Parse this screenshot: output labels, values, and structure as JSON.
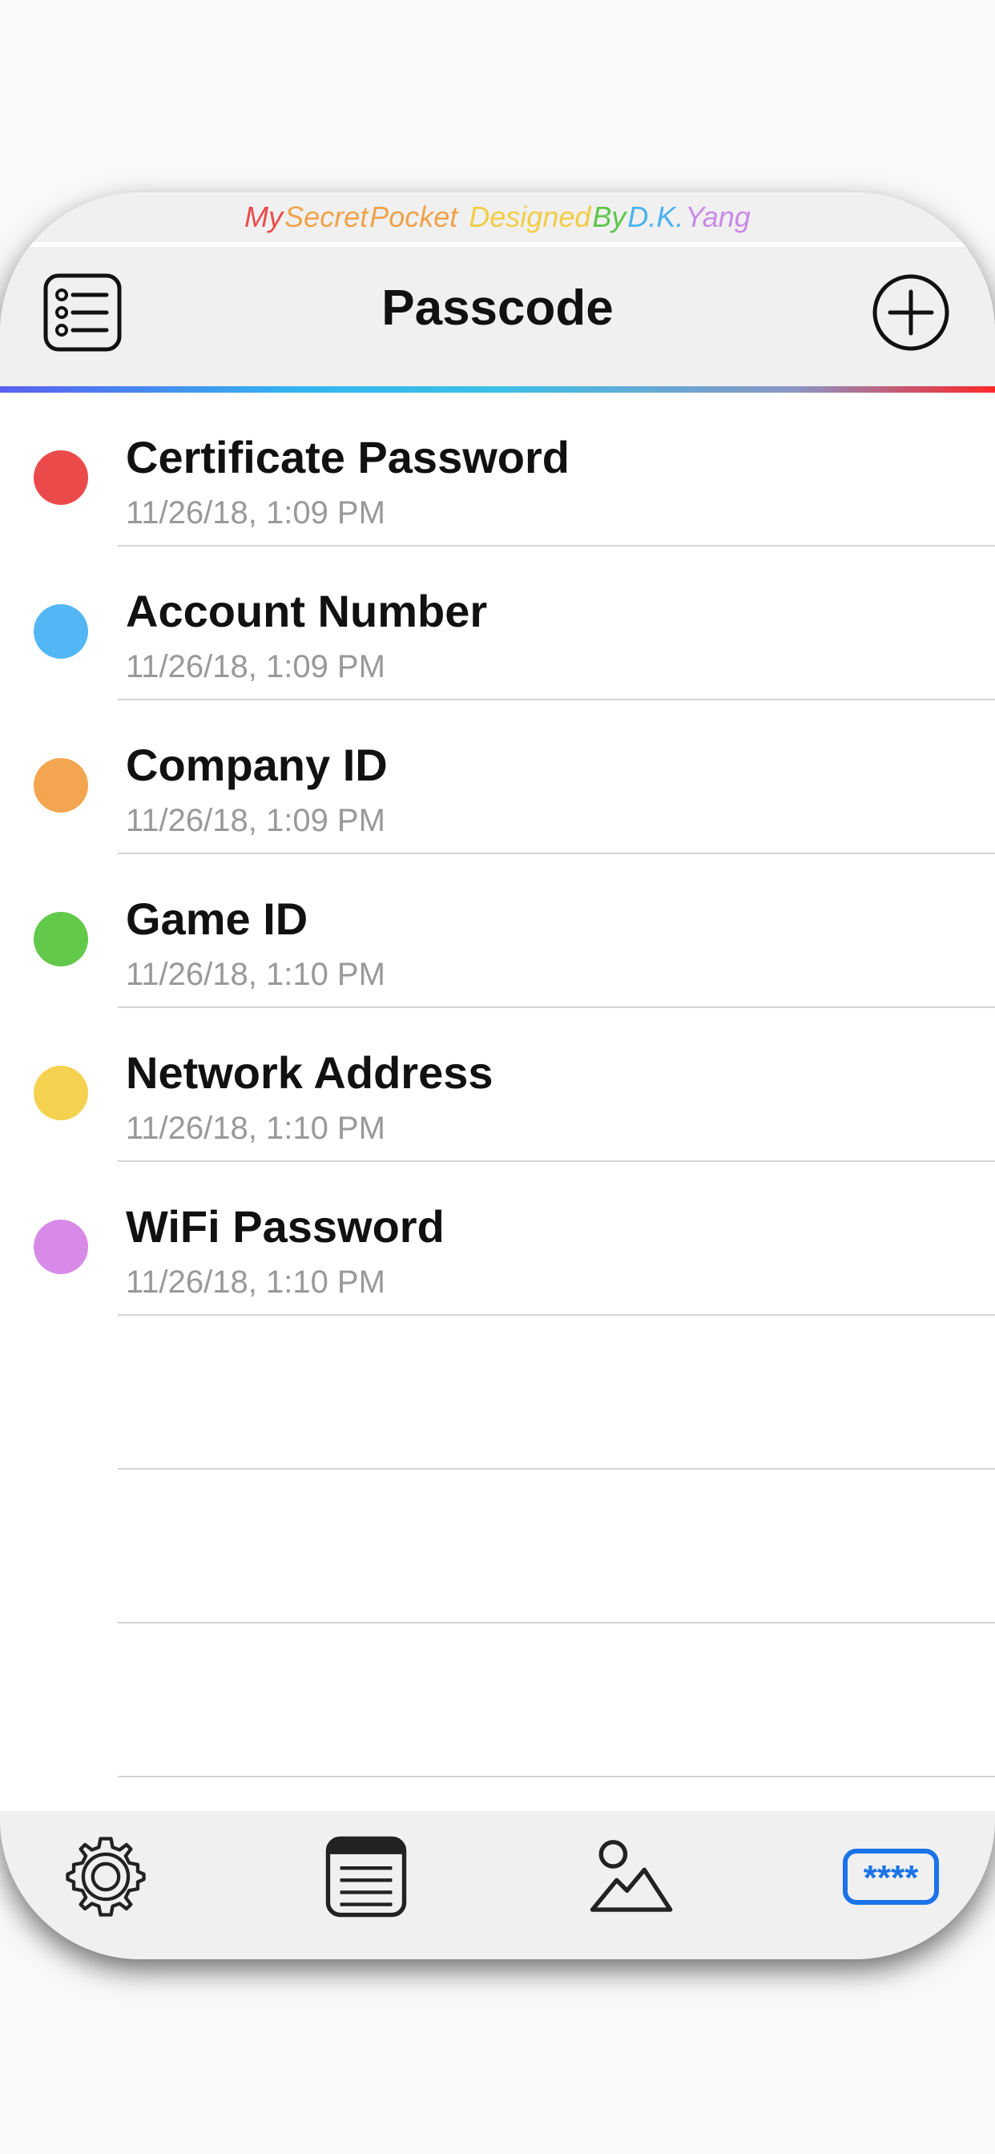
{
  "banner": {
    "words": [
      {
        "text": "My",
        "color": "#e84a4a"
      },
      {
        "text": "Secret",
        "color": "#f0a24a"
      },
      {
        "text": "Pocket",
        "color": "#f0a24a"
      },
      {
        "text": " ",
        "color": "#ffffff"
      },
      {
        "text": "Designed",
        "color": "#f2cd45"
      },
      {
        "text": "By",
        "color": "#5ec54a"
      },
      {
        "text": "D.K.",
        "color": "#4ab3ef"
      },
      {
        "text": "Yang",
        "color": "#c98ae6"
      }
    ]
  },
  "navbar": {
    "title": "Passcode",
    "left_icon": "list-icon",
    "right_icon": "add-circle-icon"
  },
  "items": [
    {
      "title": "Certificate Password",
      "date": "11/26/18, 1:09 PM",
      "color": "#eb4a4a"
    },
    {
      "title": "Account Number",
      "date": "11/26/18, 1:09 PM",
      "color": "#54b7f5"
    },
    {
      "title": "Company ID",
      "date": "11/26/18, 1:09 PM",
      "color": "#f4a550"
    },
    {
      "title": "Game ID",
      "date": "11/26/18, 1:10 PM",
      "color": "#62c94a"
    },
    {
      "title": "Network Address",
      "date": "11/26/18, 1:10 PM",
      "color": "#f5d150"
    },
    {
      "title": "WiFi Password",
      "date": "11/26/18, 1:10 PM",
      "color": "#d88ae8"
    }
  ],
  "empty_rows": 3,
  "tabbar": {
    "tabs": [
      {
        "icon": "gear-icon",
        "active": false
      },
      {
        "icon": "notes-icon",
        "active": false
      },
      {
        "icon": "photo-icon",
        "active": false
      },
      {
        "icon": "passcode-icon",
        "active": true
      }
    ],
    "active_color": "#1a73e8",
    "inactive_color": "#222222"
  },
  "colors": {
    "bar_background": "#f0f0f0",
    "separator": "#d4d4d4",
    "subtitle": "#999999"
  }
}
